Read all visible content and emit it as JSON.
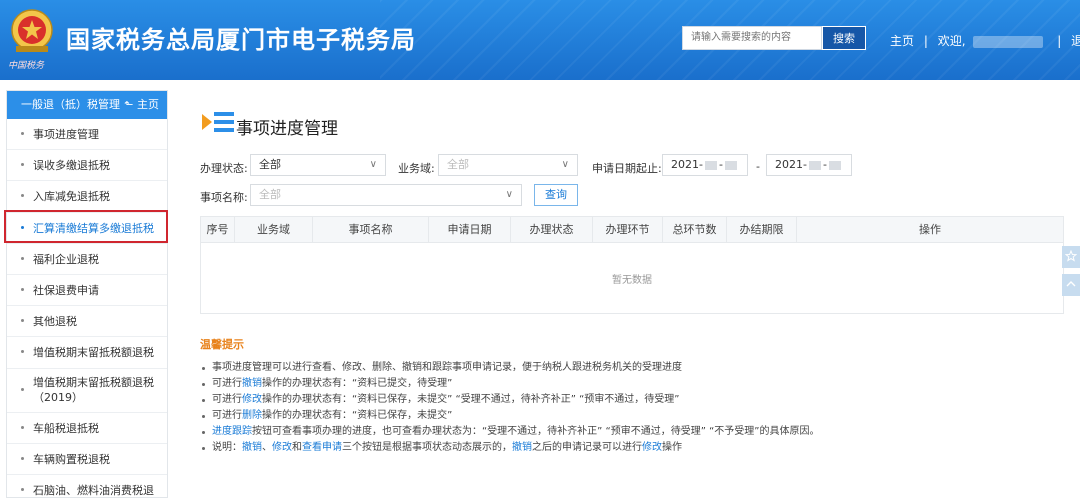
{
  "header": {
    "site_title": "国家税务总局厦门市电子税务局",
    "emblem_caption": "中国税务",
    "search_placeholder": "请输入需要搜索的内容",
    "search_button": "搜索",
    "home_link": "主页",
    "welcome_text": "欢迎,",
    "logout_link": "退出",
    "separator": "|",
    "brand_color": "#1a6fcc"
  },
  "sidebar": {
    "title": "一般退（抵）税管理",
    "home_link": "主页",
    "items": [
      {
        "label": "事项进度管理"
      },
      {
        "label": "误收多缴退抵税"
      },
      {
        "label": "入库减免退抵税"
      },
      {
        "label": "汇算清缴结算多缴退抵税"
      },
      {
        "label": "福利企业退税"
      },
      {
        "label": "社保退费申请"
      },
      {
        "label": "其他退税"
      },
      {
        "label": "增值税期末留抵税额退税"
      },
      {
        "label": "增值税期末留抵税额退税（2019）"
      },
      {
        "label": "车船税退抵税"
      },
      {
        "label": "车辆购置税退税"
      },
      {
        "label": "石脑油、燃料油消费税退"
      }
    ]
  },
  "main": {
    "page_title": "事项进度管理",
    "filters": {
      "status_label": "办理状态:",
      "status_value": "全部",
      "domain_label": "业务域:",
      "domain_placeholder": "全部",
      "date_label": "申请日期起止:",
      "date_from": "2021-",
      "date_dash": "-",
      "date_to": "2021-",
      "name_label": "事项名称:",
      "name_placeholder": "全部",
      "query_button": "查询"
    },
    "table": {
      "columns": [
        "序号",
        "业务域",
        "事项名称",
        "申请日期",
        "办理状态",
        "办理环节",
        "总环节数",
        "办结期限",
        "操作"
      ],
      "empty_text": "暂无数据"
    },
    "tips": {
      "title": "温馨提示",
      "line1": "事项进度管理可以进行查看、修改、删除、撤销和跟踪事项申请记录，便于纳税人跟进税务机关的受理进度",
      "line2_a": "可进行",
      "line2_link": "撤销",
      "line2_b": "操作的办理状态有：“资料已提交，待受理”",
      "line3_a": "可进行",
      "line3_link": "修改",
      "line3_b": "操作的办理状态有：“资料已保存，未提交” “受理不通过，待补齐补正” “预审不通过，待受理”",
      "line4_a": "可进行",
      "line4_link": "删除",
      "line4_b": "操作的办理状态有：“资料已保存，未提交”",
      "line5_link": "进度跟踪",
      "line5_b": "按钮可查看事项办理的进度，也可查看办理状态为：“受理不通过，待补齐补正” “预审不通过，待受理” “不予受理”的具体原因。",
      "line6_a": "说明：",
      "line6_link1": "撤销",
      "line6_sep": "、",
      "line6_link2": "修改",
      "line6_and": "和",
      "line6_link3": "查看申请",
      "line6_b": "三个按钮是根据事项状态动态展示的，",
      "line6_link4": "撤销",
      "line6_c": "之后的申请记录可以进行",
      "line6_link5": "修改",
      "line6_d": "操作"
    }
  }
}
